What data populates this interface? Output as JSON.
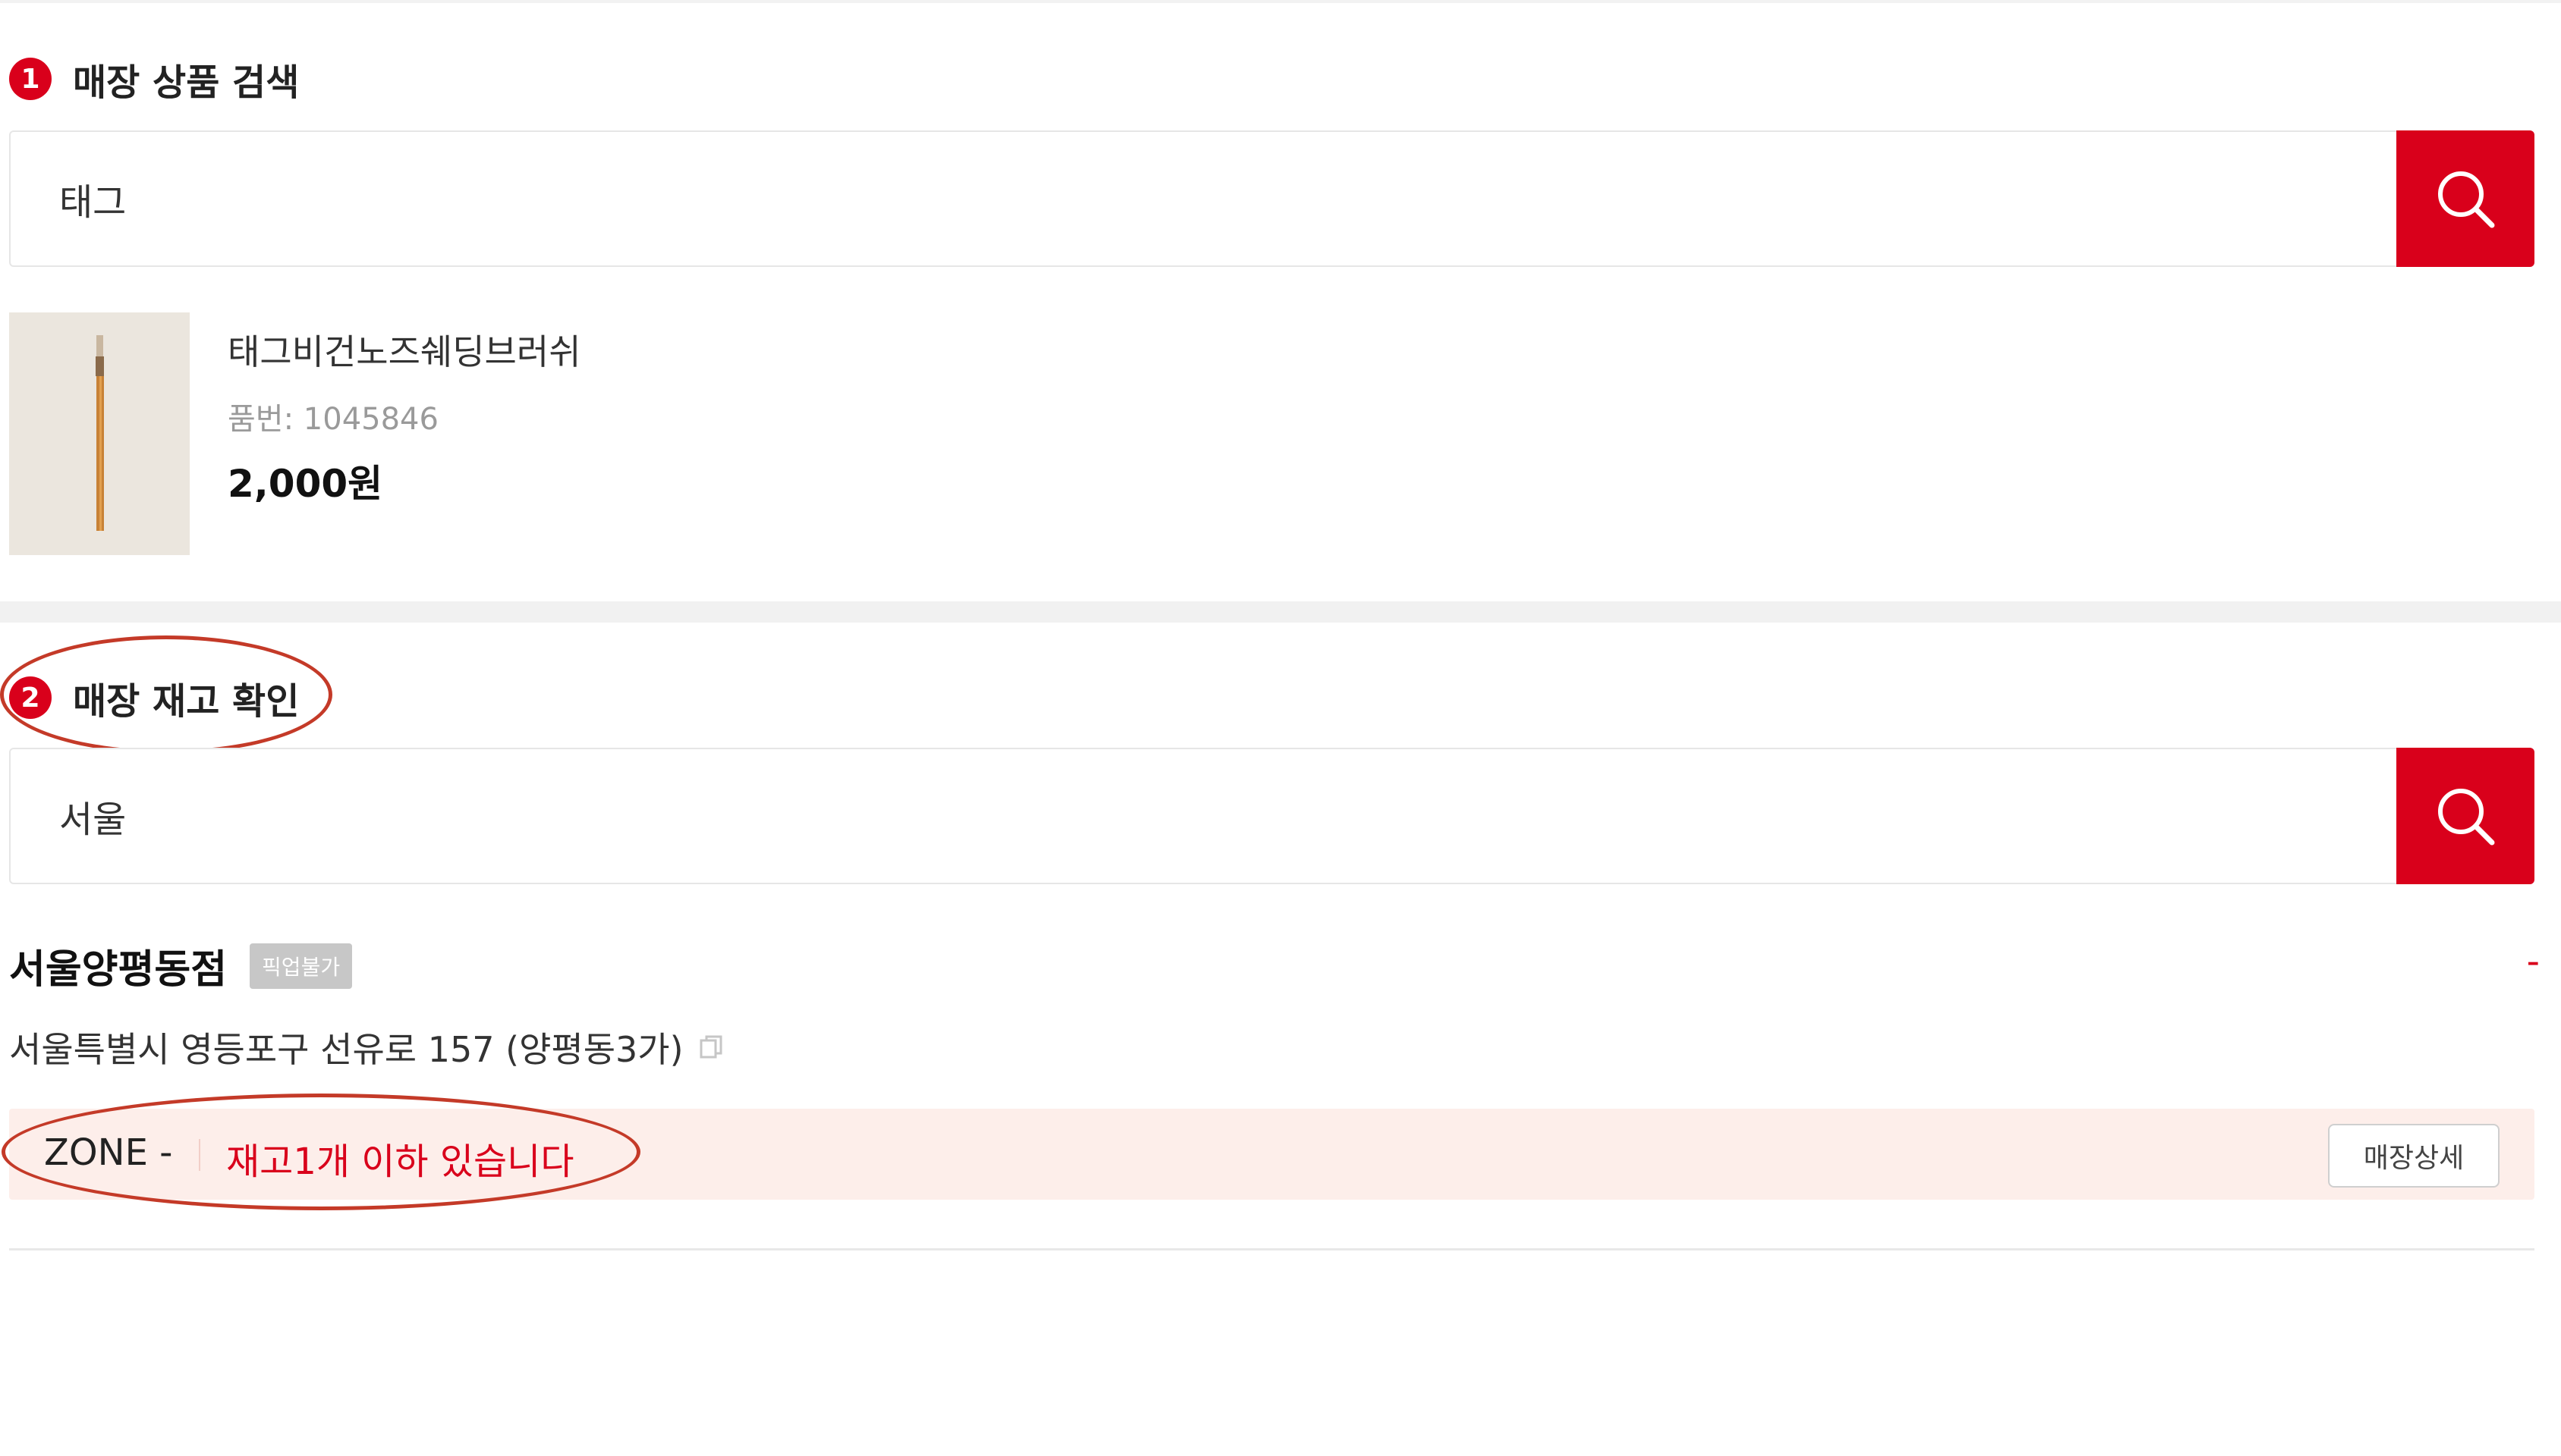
{
  "product_search": {
    "step": "1",
    "title": "매장 상품 검색",
    "query": "태그"
  },
  "product": {
    "name": "태그비건노즈쉐딩브러쉬",
    "code": "품번: 1045846",
    "price": "2,000원"
  },
  "stock_check": {
    "step": "2",
    "title": "매장 재고 확인",
    "query": "서울"
  },
  "store": {
    "name": "서울양평동점",
    "pickup_badge": "픽업불가",
    "right_text": "-",
    "address": "서울특별시 영등포구 선유로 157 (양평동3가)",
    "zone": "ZONE -",
    "stock_message": "재고1개 이하 있습니다",
    "detail_button": "매장상세"
  },
  "colors": {
    "brand_red": "#d9001b",
    "stock_bar_bg": "#fdeeea",
    "annotation_ring": "#c43a28"
  },
  "icons": {
    "search": "search-icon",
    "copy": "copy-icon"
  }
}
